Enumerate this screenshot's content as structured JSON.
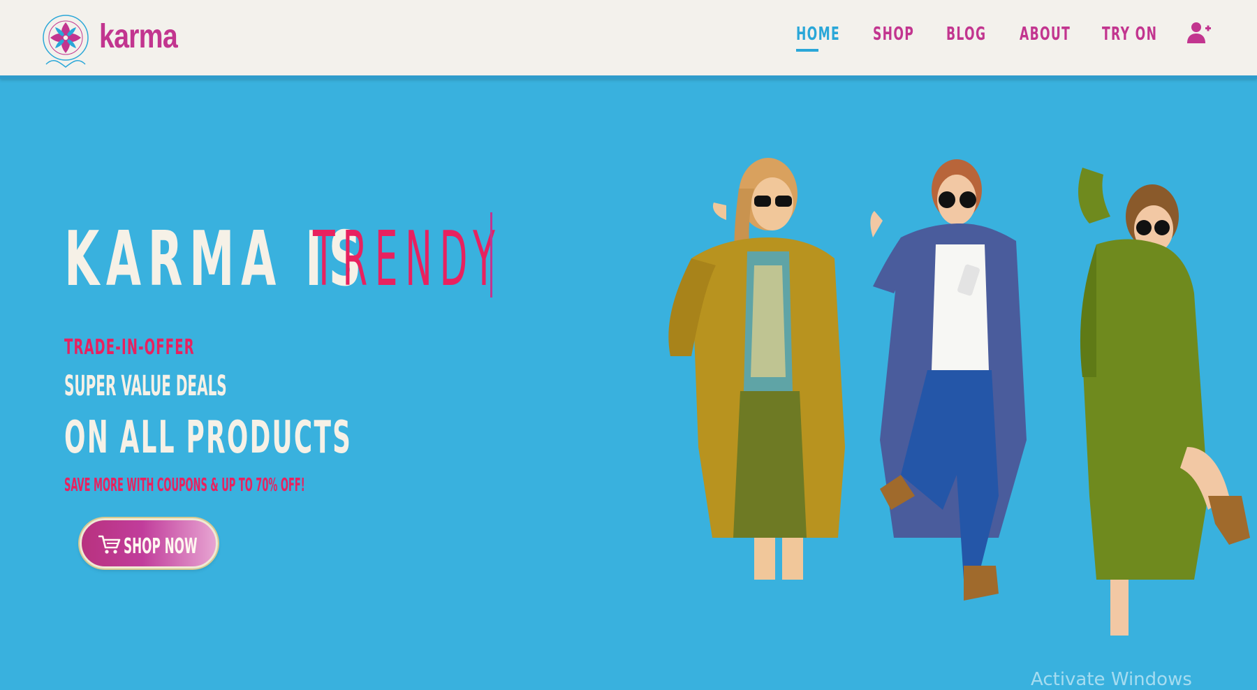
{
  "brand": {
    "name": "karma",
    "colors": {
      "primary": "#c2358f",
      "accent": "#e8215f",
      "hero_bg": "#39b1de",
      "nav_active": "#2aa7d8",
      "header_bg": "#f3f1ec"
    }
  },
  "nav": {
    "items": [
      {
        "label": "HOME",
        "active": true
      },
      {
        "label": "SHOP",
        "active": false
      },
      {
        "label": "BLOG",
        "active": false
      },
      {
        "label": "ABOUT",
        "active": false
      },
      {
        "label": "TRY ON",
        "active": false
      }
    ],
    "user_icon": "user-plus-icon"
  },
  "hero": {
    "static_text": "KARMA IS",
    "typed_word": "TRENDY",
    "offer_kicker": "TRADE-IN-OFFER",
    "offer_line1": "SUPER VALUE DEALS",
    "offer_line2": "ON ALL PRODUCTS",
    "offer_sub": "SAVE MORE WITH COUPONS & UP TO 70% OFF!",
    "cta_label": "SHOP NOW",
    "cta_icon": "cart-icon"
  },
  "overlay": {
    "watermark": "Activate Windows"
  }
}
